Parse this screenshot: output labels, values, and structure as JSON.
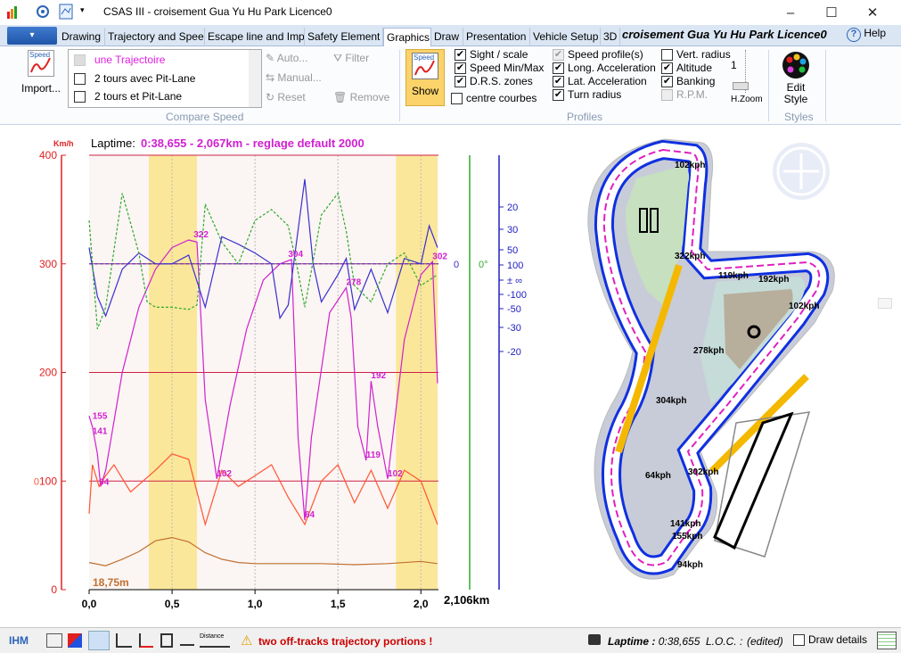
{
  "window": {
    "title": "CSAS III - croisement Gua Yu Hu Park Licence0",
    "minimize": "–",
    "maximize": "☐",
    "close": "✕"
  },
  "tabs": [
    "Drawing",
    "Trajectory and Spee",
    "Escape line and Imp",
    "Safety Element",
    "Graphics",
    "Draw",
    "Presentation",
    "Vehicle Setup",
    "3D"
  ],
  "active_tab": "Graphics",
  "circuit_title": "croisement Gua Yu Hu Park Licence0",
  "help": "Help",
  "ribbon": {
    "import_label": "Import...",
    "import_icon_text": "Speed",
    "compare": {
      "items": [
        "une Trajectoire",
        "2 tours avec Pit-Lane",
        "2 tours et Pit-Lane"
      ],
      "auto": "Auto...",
      "manual": "Manual...",
      "reset": "Reset",
      "filter": "Filter",
      "remove": "Remove",
      "label": "Compare Speed"
    },
    "show_label": "Show",
    "show_icon_text": "Speed",
    "profiles": {
      "label": "Profiles",
      "col1": [
        {
          "label": "Sight / scale",
          "checked": true
        },
        {
          "label": "Speed Min/Max",
          "checked": true
        },
        {
          "label": "D.R.S. zones",
          "checked": true
        },
        {
          "label": "centre courbes",
          "checked": false
        }
      ],
      "col2": [
        {
          "label": "Speed profile(s)",
          "checked": true,
          "disabled": true
        },
        {
          "label": "Long. Acceleration",
          "checked": true
        },
        {
          "label": "Lat. Acceleration",
          "checked": true
        },
        {
          "label": "Turn radius",
          "checked": true
        }
      ],
      "col3": [
        {
          "label": "Vert. radius",
          "checked": false
        },
        {
          "label": "Altitude",
          "checked": true
        },
        {
          "label": "Banking",
          "checked": true
        },
        {
          "label": "R.P.M.",
          "checked": false,
          "disabled": true
        }
      ]
    },
    "hzoom_label": "H.Zoom",
    "hzoom_value": "1",
    "styles": {
      "edit_label": "Edit Style",
      "label": "Styles"
    }
  },
  "chart_data": {
    "type": "line",
    "title": "Laptime:",
    "subtitle": "0:38,655 - 2,067km - reglage default 2000",
    "ylabel": "Km/h",
    "ylim": [
      0,
      400
    ],
    "yticks": [
      0,
      100,
      200,
      300,
      400
    ],
    "xlim": [
      0,
      2.106
    ],
    "xticks": [
      "0,0",
      "0,5",
      "1,0",
      "1,5",
      "2,0"
    ],
    "x_end_label": "2,106km",
    "right_axis_green": "0°",
    "right_axis_blue_ticks": [
      "20",
      "30",
      "50",
      "100",
      "± ∞",
      "-100",
      "-50",
      "-30",
      "-20"
    ],
    "zero_labels": [
      "0",
      "0"
    ],
    "altitude_label": "18,75m",
    "grid": true,
    "legend": "none",
    "drs_zones": [
      [
        0.36,
        0.65
      ],
      [
        1.85,
        2.1
      ]
    ],
    "speed_labels": [
      {
        "x": 0.63,
        "y": 322,
        "t": "322"
      },
      {
        "x": 1.2,
        "y": 304,
        "t": "304"
      },
      {
        "x": 1.55,
        "y": 278,
        "t": "278"
      },
      {
        "x": 2.07,
        "y": 302,
        "t": "302"
      },
      {
        "x": 0.02,
        "y": 155,
        "t": "155"
      },
      {
        "x": 0.02,
        "y": 141,
        "t": "141"
      },
      {
        "x": 0.06,
        "y": 94,
        "t": "94"
      },
      {
        "x": 0.77,
        "y": 102,
        "t": "102"
      },
      {
        "x": 1.3,
        "y": 64,
        "t": "64"
      },
      {
        "x": 1.7,
        "y": 192,
        "t": "192"
      },
      {
        "x": 1.67,
        "y": 119,
        "t": "119"
      },
      {
        "x": 1.8,
        "y": 102,
        "t": "102"
      }
    ],
    "series": [
      {
        "color": "#d020d0",
        "x": [
          0,
          0.02,
          0.05,
          0.07,
          0.1,
          0.2,
          0.3,
          0.4,
          0.5,
          0.6,
          0.65,
          0.7,
          0.77,
          0.85,
          0.95,
          1.05,
          1.15,
          1.22,
          1.26,
          1.3,
          1.34,
          1.45,
          1.55,
          1.58,
          1.62,
          1.67,
          1.7,
          1.74,
          1.8,
          1.9,
          2.0,
          2.07,
          2.1
        ],
        "y": [
          160,
          150,
          125,
          95,
          110,
          200,
          260,
          295,
          315,
          322,
          320,
          175,
          102,
          170,
          240,
          285,
          300,
          304,
          140,
          64,
          140,
          255,
          278,
          250,
          150,
          119,
          192,
          150,
          102,
          230,
          290,
          302,
          190
        ]
      },
      {
        "color": "#3a2fd0",
        "x": [
          0,
          0.05,
          0.1,
          0.2,
          0.3,
          0.4,
          0.5,
          0.6,
          0.7,
          0.8,
          0.9,
          1.0,
          1.1,
          1.15,
          1.2,
          1.25,
          1.3,
          1.35,
          1.4,
          1.5,
          1.55,
          1.6,
          1.7,
          1.8,
          1.9,
          2.0,
          2.05,
          2.1
        ],
        "y": [
          315,
          270,
          252,
          295,
          310,
          300,
          300,
          308,
          260,
          325,
          318,
          310,
          300,
          250,
          262,
          320,
          378,
          300,
          265,
          290,
          305,
          258,
          295,
          255,
          305,
          300,
          335,
          315
        ]
      },
      {
        "color": "#2eaa2e",
        "x": [
          0,
          0.05,
          0.1,
          0.2,
          0.3,
          0.35,
          0.4,
          0.5,
          0.6,
          0.65,
          0.7,
          0.8,
          0.9,
          1.0,
          1.1,
          1.2,
          1.25,
          1.3,
          1.4,
          1.5,
          1.55,
          1.6,
          1.7,
          1.8,
          1.9,
          2.0,
          2.1
        ],
        "y": [
          340,
          240,
          260,
          365,
          310,
          265,
          260,
          260,
          258,
          262,
          355,
          320,
          300,
          340,
          350,
          335,
          300,
          260,
          345,
          365,
          330,
          280,
          265,
          300,
          310,
          280,
          290
        ]
      },
      {
        "color": "#ff5533",
        "x": [
          0,
          0.02,
          0.06,
          0.1,
          0.15,
          0.25,
          0.4,
          0.5,
          0.6,
          0.7,
          0.8,
          0.9,
          1.0,
          1.1,
          1.2,
          1.3,
          1.4,
          1.5,
          1.6,
          1.7,
          1.8,
          1.9,
          2.0,
          2.1
        ],
        "y": [
          70,
          115,
          95,
          105,
          115,
          90,
          110,
          125,
          120,
          60,
          110,
          95,
          105,
          115,
          85,
          60,
          100,
          115,
          80,
          110,
          75,
          110,
          100,
          60
        ]
      },
      {
        "color": "#c07030",
        "x": [
          0,
          0.1,
          0.2,
          0.3,
          0.4,
          0.5,
          0.6,
          0.7,
          0.8,
          0.9,
          1.0,
          1.2,
          1.4,
          1.6,
          1.8,
          2.0,
          2.1
        ],
        "y": [
          25,
          22,
          28,
          35,
          45,
          48,
          44,
          34,
          28,
          25,
          24,
          24,
          24,
          23,
          24,
          26,
          24
        ]
      }
    ]
  },
  "map": {
    "speed_labels": [
      "102kph",
      "322kph",
      "119kph",
      "192kph",
      "102kph",
      "278kph",
      "304kph",
      "64kph",
      "302kph",
      "141kph",
      "155kph",
      "94kph"
    ]
  },
  "status": {
    "ihm": "IHM",
    "warning": "two off-tracks trajectory portions !",
    "laptime_label": "Laptime :",
    "laptime_value": "0:38,655",
    "loc": "L.O.C. :",
    "edited": "(edited)",
    "draw_details": "Draw details"
  },
  "colors": {
    "accent": "#2b63b8",
    "warning": "#cc0000",
    "drs": "#fbe79a",
    "speed": "#d020d0"
  }
}
